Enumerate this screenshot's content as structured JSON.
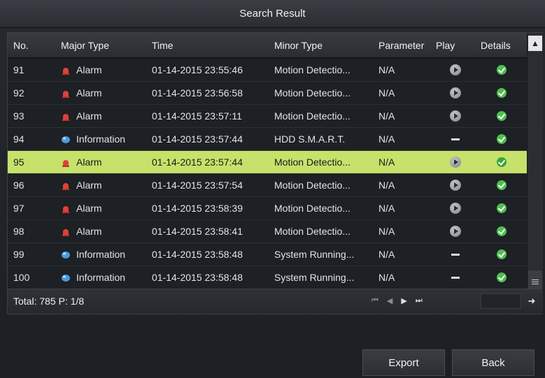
{
  "window": {
    "title": "Search Result"
  },
  "table": {
    "columns": [
      "No.",
      "Major Type",
      "Time",
      "Minor Type",
      "Parameter",
      "Play",
      "Details"
    ],
    "rows": [
      {
        "no": "91",
        "major_type": "Alarm",
        "major_icon": "alarm-icon",
        "time": "01-14-2015 23:55:46",
        "minor_type": "Motion Detectio...",
        "parameter": "N/A",
        "play": "play-icon",
        "details": "check-icon"
      },
      {
        "no": "92",
        "major_type": "Alarm",
        "major_icon": "alarm-icon",
        "time": "01-14-2015 23:56:58",
        "minor_type": "Motion Detectio...",
        "parameter": "N/A",
        "play": "play-icon",
        "details": "check-icon"
      },
      {
        "no": "93",
        "major_type": "Alarm",
        "major_icon": "alarm-icon",
        "time": "01-14-2015 23:57:11",
        "minor_type": "Motion Detectio...",
        "parameter": "N/A",
        "play": "play-icon",
        "details": "check-icon"
      },
      {
        "no": "94",
        "major_type": "Information",
        "major_icon": "information-icon",
        "time": "01-14-2015 23:57:44",
        "minor_type": "HDD S.M.A.R.T.",
        "parameter": "N/A",
        "play": "dash-icon",
        "details": "check-icon"
      },
      {
        "no": "95",
        "major_type": "Alarm",
        "major_icon": "alarm-icon",
        "time": "01-14-2015 23:57:44",
        "minor_type": "Motion Detectio...",
        "parameter": "N/A",
        "play": "play-icon",
        "details": "check-icon",
        "selected": true
      },
      {
        "no": "96",
        "major_type": "Alarm",
        "major_icon": "alarm-icon",
        "time": "01-14-2015 23:57:54",
        "minor_type": "Motion Detectio...",
        "parameter": "N/A",
        "play": "play-icon",
        "details": "check-icon"
      },
      {
        "no": "97",
        "major_type": "Alarm",
        "major_icon": "alarm-icon",
        "time": "01-14-2015 23:58:39",
        "minor_type": "Motion Detectio...",
        "parameter": "N/A",
        "play": "play-icon",
        "details": "check-icon"
      },
      {
        "no": "98",
        "major_type": "Alarm",
        "major_icon": "alarm-icon",
        "time": "01-14-2015 23:58:41",
        "minor_type": "Motion Detectio...",
        "parameter": "N/A",
        "play": "play-icon",
        "details": "check-icon"
      },
      {
        "no": "99",
        "major_type": "Information",
        "major_icon": "information-icon",
        "time": "01-14-2015 23:58:48",
        "minor_type": "System Running...",
        "parameter": "N/A",
        "play": "dash-icon",
        "details": "check-icon"
      },
      {
        "no": "100",
        "major_type": "Information",
        "major_icon": "information-icon",
        "time": "01-14-2015 23:58:48",
        "minor_type": "System Running...",
        "parameter": "N/A",
        "play": "dash-icon",
        "details": "check-icon"
      }
    ]
  },
  "footer": {
    "total_text": "Total: 785  P: 1/8",
    "pager_icons": [
      "first-page-icon",
      "prev-page-icon",
      "next-page-icon",
      "last-page-icon"
    ],
    "page_input_value": "",
    "go_icon": "go-arrow-icon"
  },
  "buttons": {
    "export": "Export",
    "back": "Back"
  },
  "colors": {
    "selected_row": "#c6e26a",
    "alarm": "#e0403a",
    "information": "#4a9be0",
    "check": "#4fbf4f"
  }
}
